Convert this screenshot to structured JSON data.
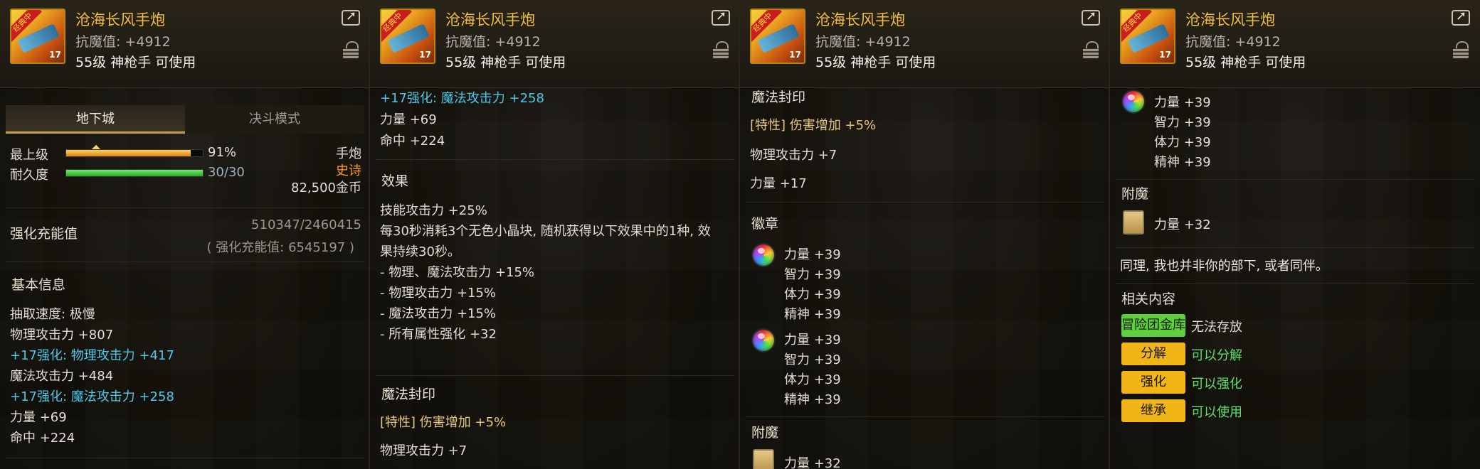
{
  "item": {
    "name": "沧海长风手炮",
    "resist": "抗魔值: +4912",
    "requirement": "55级 神枪手 可使用",
    "icon_badge": "经典中",
    "icon_tag": "17"
  },
  "panel1": {
    "tabs": [
      "地下城",
      "决斗模式"
    ],
    "max_level_label": "最上级",
    "max_level_value": "91%",
    "max_level_fraction": 0.91,
    "durability_label": "耐久度",
    "durability_value": "30/30",
    "durability_fraction": 1.0,
    "weapon_type": "手炮",
    "rarity": "史诗",
    "price": "82,500金币",
    "charge_label": "强化充能值",
    "charge_value": "510347/2460415",
    "charge_total": "( 强化充能值: 6545197 )",
    "basic_info": "基本信息",
    "lines": [
      {
        "text": "抽取速度: 极慢",
        "color": "normal"
      },
      {
        "text": "物理攻击力 +807",
        "color": "normal"
      },
      {
        "text": "+17强化: 物理攻击力 +417",
        "color": "cyan"
      },
      {
        "text": "魔法攻击力 +484",
        "color": "normal"
      },
      {
        "text": "+17强化: 魔法攻击力 +258",
        "color": "cyan"
      },
      {
        "text": "力量 +69",
        "color": "normal"
      },
      {
        "text": "命中 +224",
        "color": "normal"
      }
    ]
  },
  "panel2": {
    "top_lines": [
      {
        "text": "+17强化: 魔法攻击力 +258",
        "color": "cyan"
      },
      {
        "text": "力量 +69",
        "color": "normal"
      },
      {
        "text": "命中 +224",
        "color": "normal"
      }
    ],
    "effect_title": "效果",
    "effect_lines": [
      "技能攻击力 +25%",
      "每30秒消耗3个无色小晶块, 随机获得以下效果中的1种, 效",
      "果持续30秒。",
      "- 物理、魔法攻击力 +15%",
      "- 物理攻击力 +15%",
      "- 魔法攻击力 +15%",
      "- 所有属性强化 +32"
    ],
    "seal_title": "魔法封印",
    "seal_trait": "[特性] 伤害增加 +5%",
    "seal_line": "物理攻击力 +7"
  },
  "panel3": {
    "seal_title": "魔法封印",
    "seal_trait": "[特性] 伤害增加 +5%",
    "seal_lines": [
      "物理攻击力 +7",
      "力量 +17"
    ],
    "emblem_title": "徽章",
    "emblems": [
      [
        "力量 +39",
        "智力 +39",
        "体力 +39",
        "精神 +39"
      ],
      [
        "力量 +39",
        "智力 +39",
        "体力 +39",
        "精神 +39"
      ]
    ],
    "enchant_title": "附魔",
    "enchant_line": "力量 +32"
  },
  "panel4": {
    "emblem_lines": [
      "力量 +39",
      "智力 +39",
      "体力 +39",
      "精神 +39"
    ],
    "enchant_title": "附魔",
    "enchant_line": "力量 +32",
    "flavor": "同理, 我也并非你的部下, 或者同伴。",
    "related_title": "相关内容",
    "related": [
      {
        "button": "冒险团金库",
        "status": "无法存放",
        "button_color": "green",
        "status_color": "normal"
      },
      {
        "button": "分解",
        "status": "可以分解",
        "button_color": "yellow",
        "status_color": "green"
      },
      {
        "button": "强化",
        "status": "可以强化",
        "button_color": "yellow",
        "status_color": "green"
      },
      {
        "button": "继承",
        "status": "可以使用",
        "button_color": "yellow",
        "status_color": "green"
      }
    ]
  },
  "colors": {
    "name_gold": "#f2c13b",
    "cyan": "#4ec8ea",
    "rarity_orange": "#ff9a1f",
    "durability_green": "#3fcf3f",
    "level_orange": "#f0a21e"
  }
}
